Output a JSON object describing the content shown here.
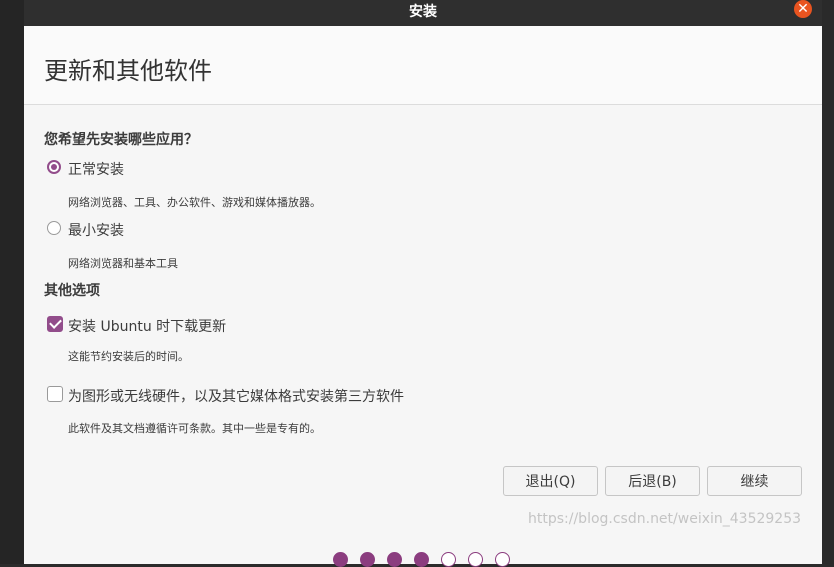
{
  "window": {
    "title": "安装"
  },
  "page": {
    "title": "更新和其他软件"
  },
  "apps_question": "您希望先安装哪些应用？",
  "install_types": [
    {
      "label": "正常安装",
      "description": "网络浏览器、工具、办公软件、游戏和媒体播放器。",
      "selected": true
    },
    {
      "label": "最小安装",
      "description": "网络浏览器和基本工具",
      "selected": false
    }
  ],
  "other_options_heading": "其他选项",
  "other_options": [
    {
      "label": "安装 Ubuntu 时下载更新",
      "description": "这能节约安装后的时间。",
      "checked": true
    },
    {
      "label": "为图形或无线硬件，以及其它媒体格式安装第三方软件",
      "description": "此软件及其文档遵循许可条款。其中一些是专有的。",
      "checked": false
    }
  ],
  "buttons": {
    "quit": "退出(Q)",
    "back": "后退(B)",
    "continue": "继续"
  },
  "progress": {
    "total": 7,
    "completed": 4
  },
  "watermark": "https://blog.csdn.net/weixin_43529253",
  "colors": {
    "accent": "#924d8b",
    "close": "#e95420",
    "titlebar": "#2f2f2f"
  },
  "icons": {
    "close": "close-icon",
    "check": "check-icon"
  }
}
